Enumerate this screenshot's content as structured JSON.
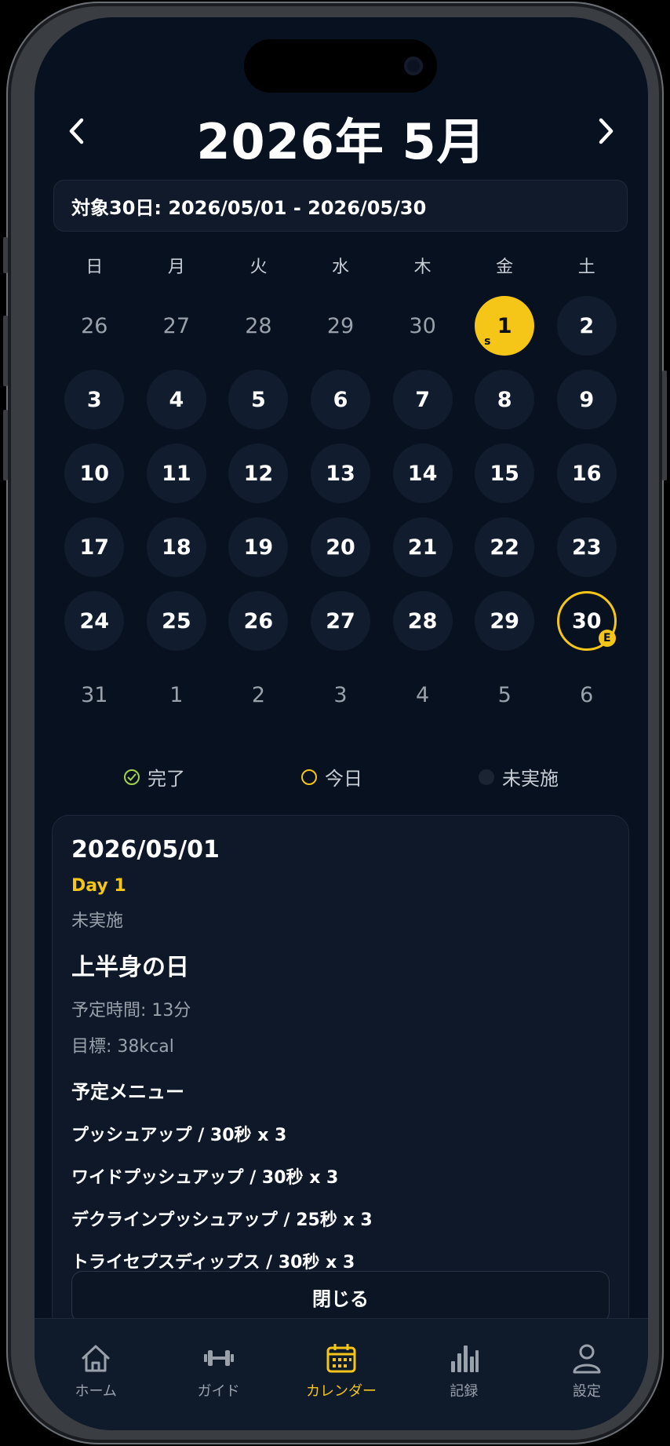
{
  "header": {
    "title": "2026年 5月",
    "prev": "‹",
    "next": "›"
  },
  "range_text": "対象30日:  2026/05/01 - 2026/05/30",
  "weekdays": [
    "日",
    "月",
    "火",
    "水",
    "木",
    "金",
    "土"
  ],
  "weeks": [
    [
      {
        "n": "26",
        "t": "other"
      },
      {
        "n": "27",
        "t": "other"
      },
      {
        "n": "28",
        "t": "other"
      },
      {
        "n": "29",
        "t": "other"
      },
      {
        "n": "30",
        "t": "other"
      },
      {
        "n": "1",
        "t": "start",
        "mark": "s"
      },
      {
        "n": "2",
        "t": "cur"
      }
    ],
    [
      {
        "n": "3",
        "t": "cur"
      },
      {
        "n": "4",
        "t": "cur"
      },
      {
        "n": "5",
        "t": "cur"
      },
      {
        "n": "6",
        "t": "cur"
      },
      {
        "n": "7",
        "t": "cur"
      },
      {
        "n": "8",
        "t": "cur"
      },
      {
        "n": "9",
        "t": "cur"
      }
    ],
    [
      {
        "n": "10",
        "t": "cur"
      },
      {
        "n": "11",
        "t": "cur"
      },
      {
        "n": "12",
        "t": "cur"
      },
      {
        "n": "13",
        "t": "cur"
      },
      {
        "n": "14",
        "t": "cur"
      },
      {
        "n": "15",
        "t": "cur"
      },
      {
        "n": "16",
        "t": "cur"
      }
    ],
    [
      {
        "n": "17",
        "t": "cur"
      },
      {
        "n": "18",
        "t": "cur"
      },
      {
        "n": "19",
        "t": "cur"
      },
      {
        "n": "20",
        "t": "cur"
      },
      {
        "n": "21",
        "t": "cur"
      },
      {
        "n": "22",
        "t": "cur"
      },
      {
        "n": "23",
        "t": "cur"
      }
    ],
    [
      {
        "n": "24",
        "t": "cur"
      },
      {
        "n": "25",
        "t": "cur"
      },
      {
        "n": "26",
        "t": "cur"
      },
      {
        "n": "27",
        "t": "cur"
      },
      {
        "n": "28",
        "t": "cur"
      },
      {
        "n": "29",
        "t": "cur"
      },
      {
        "n": "30",
        "t": "end",
        "mark": "E"
      }
    ],
    [
      {
        "n": "31",
        "t": "other"
      },
      {
        "n": "1",
        "t": "other"
      },
      {
        "n": "2",
        "t": "other"
      },
      {
        "n": "3",
        "t": "other"
      },
      {
        "n": "4",
        "t": "other"
      },
      {
        "n": "5",
        "t": "other"
      },
      {
        "n": "6",
        "t": "other"
      }
    ]
  ],
  "legend": {
    "done": "完了",
    "today": "今日",
    "pending": "未実施",
    "colors": {
      "done": "#a3d34a",
      "today": "#f5c518",
      "pending": "#1a2433"
    }
  },
  "card": {
    "date": "2026/05/01",
    "day": "Day 1",
    "status": "未実施",
    "theme": "上半身の日",
    "duration": "予定時間: 13分",
    "target": "目標: 38kcal",
    "menu_title": "予定メニュー",
    "menu": [
      "プッシュアップ / 30秒 x 3",
      "ワイドプッシュアップ / 30秒 x 3",
      "デクラインプッシュアップ / 25秒 x 3",
      "トライセプスディップス / 30秒 x 3"
    ],
    "close": "閉じる"
  },
  "tabs": [
    {
      "label": "ホーム",
      "icon": "home-icon"
    },
    {
      "label": "ガイド",
      "icon": "dumbbell-icon"
    },
    {
      "label": "カレンダー",
      "icon": "calendar-icon",
      "active": true
    },
    {
      "label": "記録",
      "icon": "bar-chart-icon"
    },
    {
      "label": "設定",
      "icon": "person-icon"
    }
  ],
  "colors": {
    "accent": "#f5c518",
    "background": "#08111f"
  }
}
